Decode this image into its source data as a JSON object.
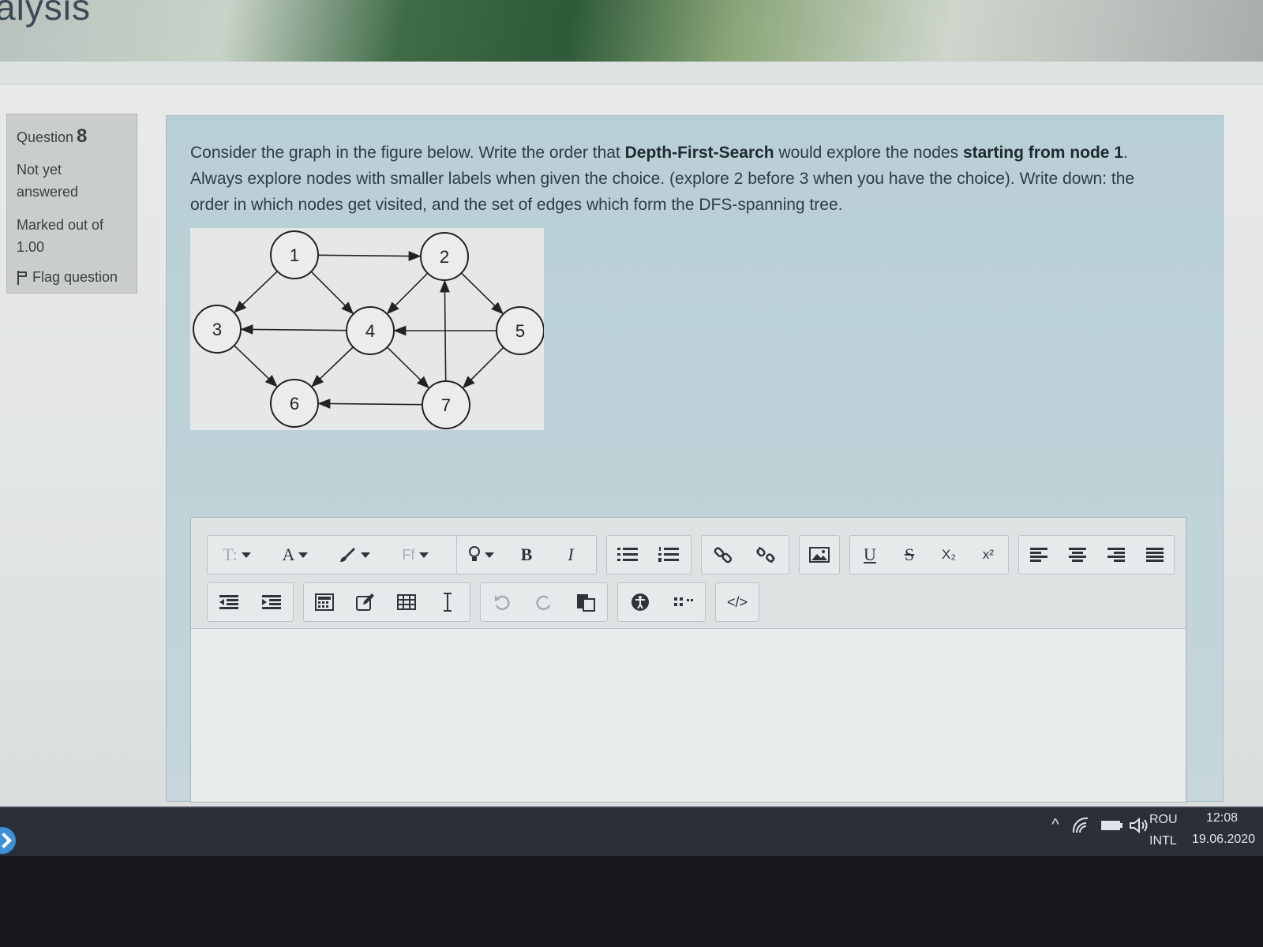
{
  "header": {
    "title": "alysis"
  },
  "question_info": {
    "label": "Question",
    "number": "8",
    "status": "Not yet answered",
    "marked": "Marked out of 1.00",
    "flag_label": "Flag question"
  },
  "question": {
    "p1": "Consider the graph in the figure below. Write the order that ",
    "b1": "Depth-First-Search",
    "p2": " would explore the nodes ",
    "b2": "starting from node 1",
    "p3": ". Always explore nodes with smaller labels when given the choice. (explore 2 before 3 when you have the choice). Write down: the order in which nodes get visited, and the set of edges which form the DFS-spanning tree."
  },
  "graph": {
    "nodes": [
      "1",
      "2",
      "3",
      "4",
      "5",
      "6",
      "7"
    ],
    "edges": [
      [
        "1",
        "2"
      ],
      [
        "1",
        "3"
      ],
      [
        "1",
        "4"
      ],
      [
        "2",
        "4"
      ],
      [
        "2",
        "5"
      ],
      [
        "4",
        "3"
      ],
      [
        "5",
        "4"
      ],
      [
        "3",
        "6"
      ],
      [
        "4",
        "6"
      ],
      [
        "4",
        "7"
      ],
      [
        "5",
        "7"
      ],
      [
        "7",
        "6"
      ],
      [
        "7",
        "2"
      ]
    ]
  },
  "toolbar": {
    "paragraph_label": "T:",
    "font_color_label": "A",
    "bold": "B",
    "italic": "I",
    "underline": "U",
    "strike": "S",
    "subscript": "X₂",
    "superscript": "x²",
    "font_label": "Ff",
    "html_label": "</>"
  },
  "taskbar": {
    "lang_top": "ROU",
    "lang_bottom": "INTL",
    "time": "12:08",
    "date": "19.06.2020"
  }
}
